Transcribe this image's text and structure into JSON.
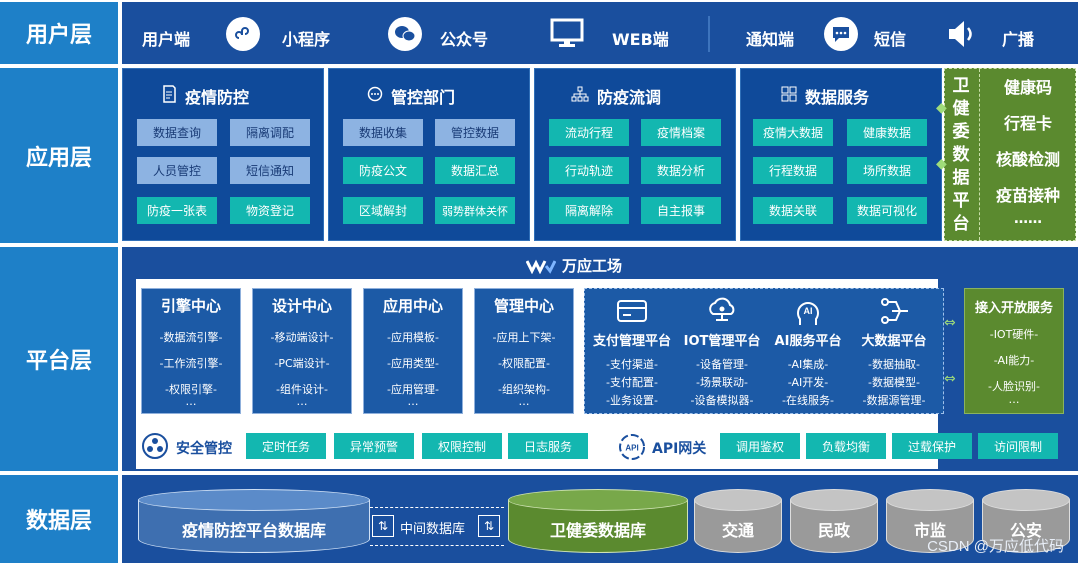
{
  "layers": {
    "user": "用户层",
    "app": "应用层",
    "platform": "平台层",
    "data": "数据层"
  },
  "user_layer": {
    "items": [
      {
        "label": "用户端",
        "icon": ""
      },
      {
        "label": "小程序",
        "icon": "mini-program-icon"
      },
      {
        "label": "公众号",
        "icon": "wechat-icon"
      },
      {
        "label": "WEB端",
        "icon": "monitor-icon"
      },
      {
        "label": "通知端",
        "icon": ""
      },
      {
        "label": "短信",
        "icon": "sms-icon"
      },
      {
        "label": "广播",
        "icon": "speaker-icon"
      }
    ]
  },
  "app_layer": {
    "groups": [
      {
        "title": "疫情防控",
        "icon": "document-icon",
        "chips": [
          "数据查询",
          "隔离调配",
          "人员管控",
          "短信通知",
          "防疫一张表",
          "物资登记"
        ]
      },
      {
        "title": "管控部门",
        "icon": "chat-icon",
        "chips": [
          "数据收集",
          "管控数据",
          "防疫公文",
          "数据汇总",
          "区域解封",
          "弱势群体关怀"
        ]
      },
      {
        "title": "防疫流调",
        "icon": "org-tree-icon",
        "chips": [
          "流动行程",
          "疫情档案",
          "行动轨迹",
          "数据分析",
          "隔离解除",
          "自主报事"
        ]
      },
      {
        "title": "数据服务",
        "icon": "grid-icon",
        "chips": [
          "疫情大数据",
          "健康数据",
          "行程数据",
          "场所数据",
          "数据关联",
          "数据可视化"
        ]
      }
    ],
    "health_platform": {
      "title": "卫健委数据平台",
      "items": [
        "健康码",
        "行程卡",
        "核酸检测",
        "疫苗接种",
        "……"
      ]
    }
  },
  "platform_layer": {
    "brand": "万应工场",
    "centers": [
      {
        "title": "引擎中心",
        "lines": [
          "-数据流引擎-",
          "-工作流引擎-",
          "-权限引擎-",
          "…"
        ]
      },
      {
        "title": "设计中心",
        "lines": [
          "-移动端设计-",
          "-PC端设计-",
          "-组件设计-",
          "…"
        ]
      },
      {
        "title": "应用中心",
        "lines": [
          "-应用模板-",
          "-应用类型-",
          "-应用管理-",
          "…"
        ]
      },
      {
        "title": "管理中心",
        "lines": [
          "-应用上下架-",
          "-权限配置-",
          "-组织架构-",
          "…"
        ]
      }
    ],
    "platforms": [
      {
        "title": "支付管理平台",
        "icon": "card-icon",
        "lines": [
          "-支付渠道-",
          "-支付配置-",
          "-业务设置-"
        ]
      },
      {
        "title": "IOT管理平台",
        "icon": "cloud-network-icon",
        "lines": [
          "-设备管理-",
          "-场景联动-",
          "-设备模拟器-"
        ]
      },
      {
        "title": "AI服务平台",
        "icon": "ai-head-icon",
        "lines": [
          "-AI集成-",
          "-AI开发-",
          "-在线服务-"
        ]
      },
      {
        "title": "大数据平台",
        "icon": "data-flow-icon",
        "lines": [
          "-数据抽取-",
          "-数据模型-",
          "-数据源管理-"
        ]
      }
    ],
    "security": {
      "title": "安全管控",
      "chips": [
        "定时任务",
        "异常预警",
        "权限控制",
        "日志服务"
      ]
    },
    "api": {
      "title": "API网关",
      "icon_text": "API",
      "chips": [
        "调用鉴权",
        "负载均衡",
        "过载保护",
        "访问限制"
      ]
    },
    "open_service": {
      "title": "接入开放服务",
      "lines": [
        "-IOT硬件-",
        "-AI能力-",
        "-人脸识别-",
        "…"
      ]
    }
  },
  "data_layer": {
    "epidemic_db": "疫情防控平台数据库",
    "middle_db": "中间数据库",
    "health_db": "卫健委数据库",
    "others": [
      "交通",
      "民政",
      "市监",
      "公安"
    ]
  },
  "watermark": "CSDN @万应低代码",
  "colors": {
    "layer_label": "#1e80c8",
    "band": "#1a4f9e",
    "box": "#0f4a9a",
    "chip_light": "#8db3e2",
    "chip_teal": "#13b7b0",
    "green": "#5b8a2f",
    "gray_db": "#b0b0b0"
  }
}
